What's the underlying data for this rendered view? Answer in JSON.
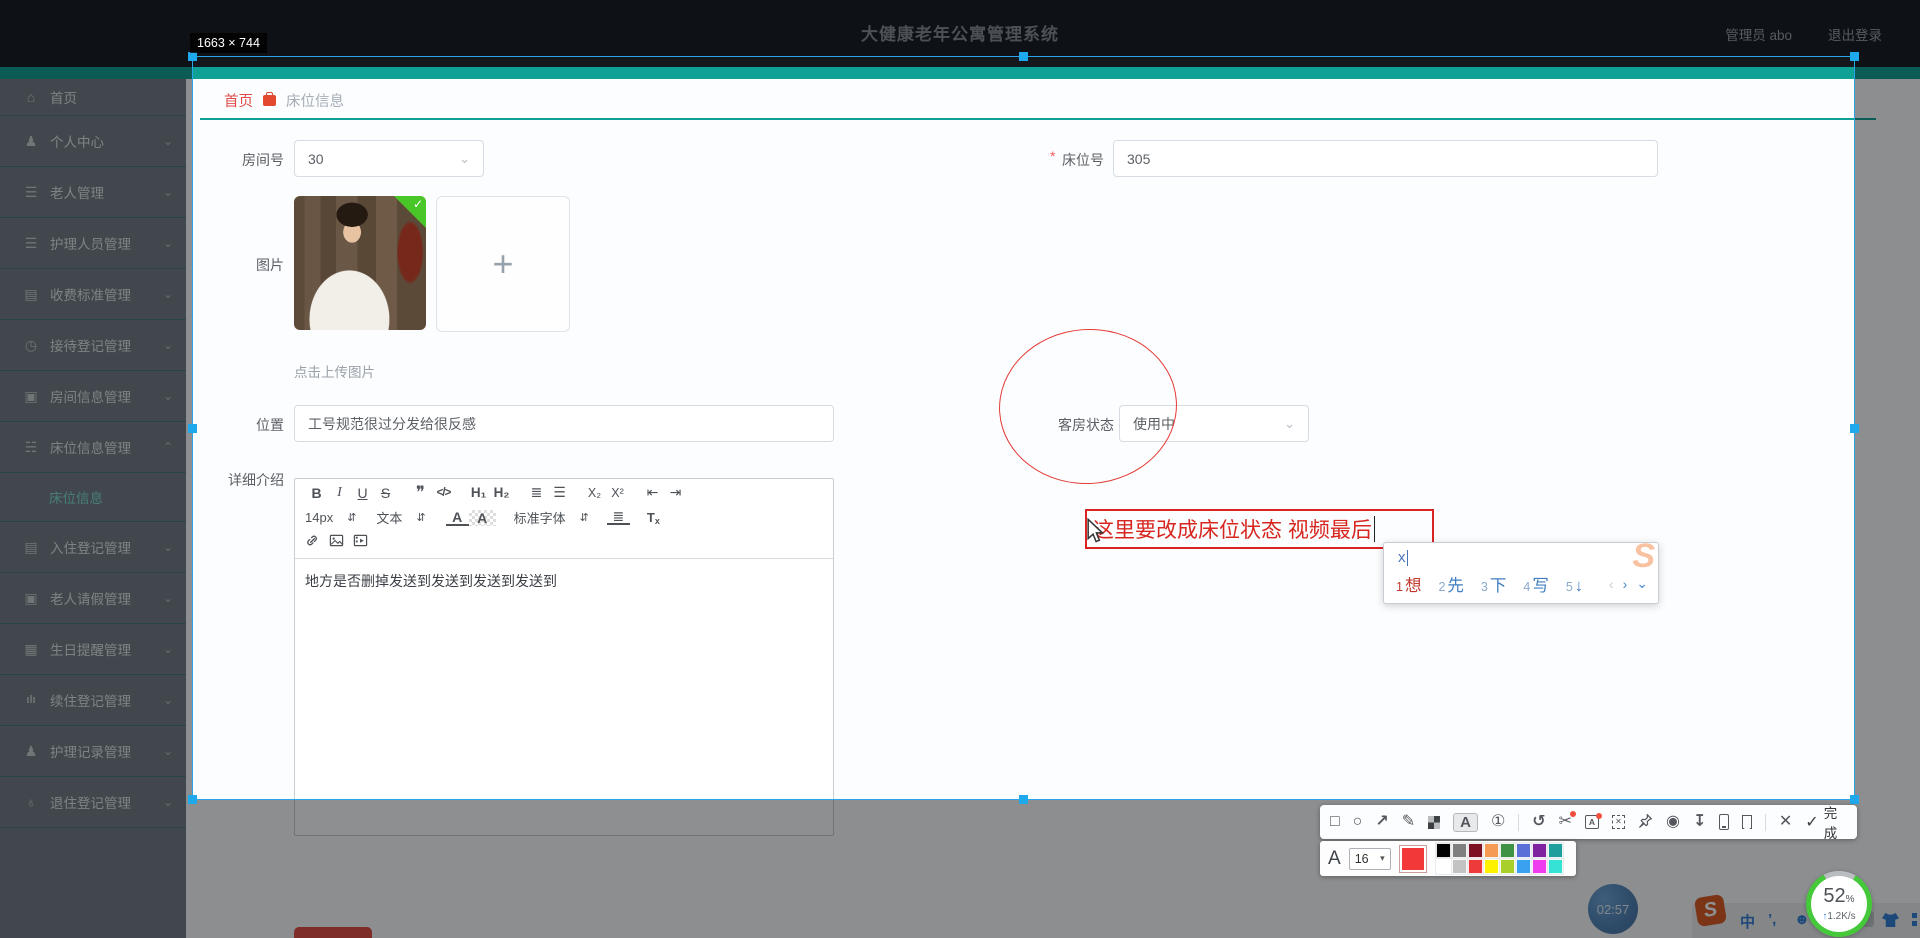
{
  "capture": {
    "size_label": "1663 × 744"
  },
  "colors": {
    "accent_teal": "#0fa195",
    "selection_blue": "#1ea9ec",
    "annotation_red": "#db2420"
  },
  "header": {
    "title": "大健康老年公寓管理系统",
    "user": "管理员 abo",
    "logout": "退出登录"
  },
  "sidebar": {
    "items": [
      {
        "label": "首页",
        "icon": "⌂",
        "chevron": ""
      },
      {
        "label": "个人中心",
        "icon": "♟",
        "chevron": "⌄"
      },
      {
        "label": "老人管理",
        "icon": "☰",
        "chevron": "⌄"
      },
      {
        "label": "护理人员管理",
        "icon": "☰",
        "chevron": "⌄"
      },
      {
        "label": "收费标准管理",
        "icon": "▤",
        "chevron": "⌄"
      },
      {
        "label": "接待登记管理",
        "icon": "◷",
        "chevron": "⌄"
      },
      {
        "label": "房间信息管理",
        "icon": "▣",
        "chevron": "⌄"
      },
      {
        "label": "床位信息管理",
        "icon": "☵",
        "chevron": "⌃"
      },
      {
        "label": "入住登记管理",
        "icon": "▤",
        "chevron": "⌄"
      },
      {
        "label": "老人请假管理",
        "icon": "▣",
        "chevron": "⌄"
      },
      {
        "label": "生日提醒管理",
        "icon": "▦",
        "chevron": "⌄"
      },
      {
        "label": "续住登记管理",
        "icon": "ılı",
        "chevron": "⌄"
      },
      {
        "label": "护理记录管理",
        "icon": "♟",
        "chevron": "⌄"
      },
      {
        "label": "退住登记管理",
        "icon": "♁",
        "chevron": "⌄"
      }
    ],
    "sub_item": "床位信息"
  },
  "breadcrumb": {
    "home": "首页",
    "current": "床位信息"
  },
  "ui": {
    "select_caret": "⌄"
  },
  "form": {
    "room": {
      "label": "房间号",
      "value": "30"
    },
    "bed": {
      "star": "*",
      "label": "床位号",
      "value": "305"
    },
    "image": {
      "label": "图片",
      "hint": "点击上传图片",
      "plus": "+",
      "check": "✓"
    },
    "location": {
      "label": "位置",
      "value": "工号规范很过分发给很反感"
    },
    "status": {
      "label": "客房状态",
      "value": "使用中"
    },
    "detail": {
      "label": "详细介绍",
      "content": "地方是否删掉发送到发送到发送到发送到",
      "toolbar": {
        "bold": "B",
        "italic": "I",
        "underline": "U",
        "strike": "S",
        "quote": "❞",
        "code": "</>",
        "h1": "H₁",
        "h2": "H₂",
        "ol": "≣",
        "ul": "☰",
        "sub": "X₂",
        "sup": "X²",
        "outdent": "⇤",
        "indent": "⇥",
        "size": "14px",
        "style": "文本",
        "font": "标准字体",
        "updown": "⇵",
        "color": "A",
        "bg": "A",
        "align": "≣",
        "clear_t": "T",
        "clear_x": "x"
      }
    }
  },
  "annotation": {
    "note": "这里要改成床位状态 视频最后"
  },
  "ime": {
    "composition": "x",
    "candidates": [
      [
        "1",
        "想"
      ],
      [
        "2",
        "先"
      ],
      [
        "3",
        "下"
      ],
      [
        "4",
        "写"
      ],
      [
        "5",
        "↓"
      ]
    ],
    "prev": "‹",
    "next": "›",
    "more": "⌄",
    "watermark": "S"
  },
  "shot_toolbar": {
    "rect": "□",
    "circle": "○",
    "arrow": "↗",
    "pen": "✎",
    "text": "A",
    "number": "①",
    "undo": "↺",
    "cut": "✂",
    "translate": "A",
    "scan": "✕",
    "record": "◉",
    "download": "↧",
    "close": "✕",
    "check": "✓",
    "done": "完成"
  },
  "font_bar": {
    "letter": "A",
    "size": "16",
    "caret": "▾",
    "current_color": "#f23838",
    "palette": [
      [
        "#000000",
        "#7f7f7f",
        "#7d1022",
        "#f59a52",
        "#3f9244",
        "#5a6fd8",
        "#7e22a0",
        "#1f9e9e"
      ],
      [
        "#ffffff",
        "#c3c3c3",
        "#ee3a3a",
        "#fff200",
        "#a8cf2a",
        "#3aa0f0",
        "#ee3cee",
        "#35e3d5"
      ]
    ]
  },
  "tray": {
    "clock": "02:57",
    "logo": "S",
    "cn": "中",
    "punct": "’,",
    "face": "☻"
  },
  "net": {
    "percent": "52",
    "unit": "%",
    "arrow": "↑",
    "speed": "1.2K/s"
  }
}
